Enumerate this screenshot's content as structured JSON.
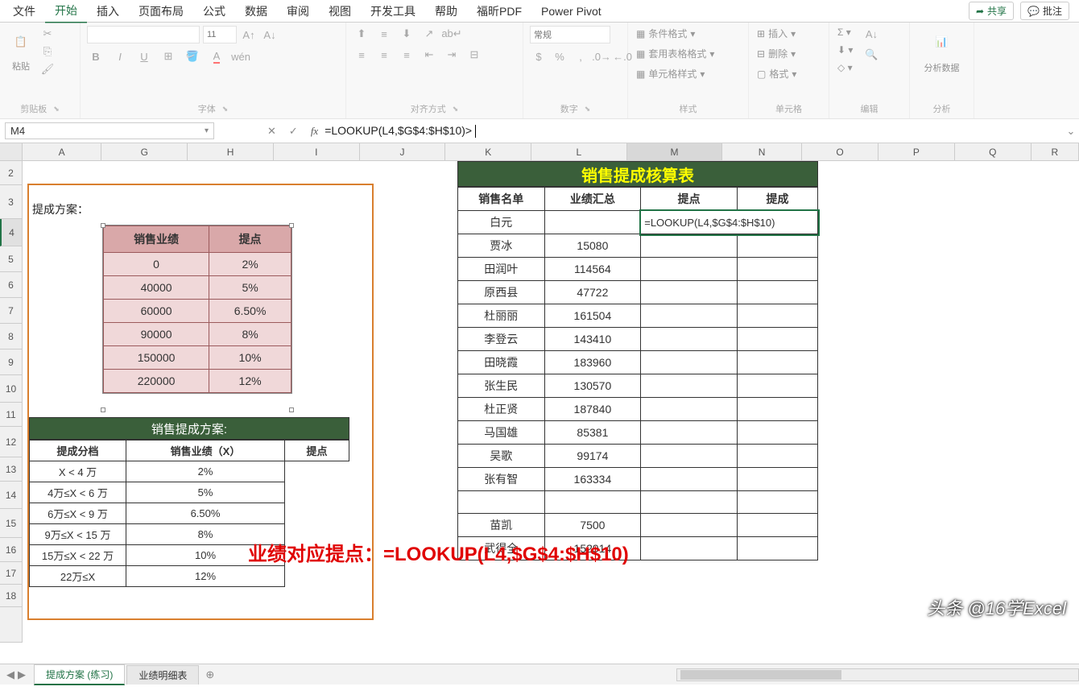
{
  "tabs": {
    "file": "文件",
    "home": "开始",
    "insert": "插入",
    "layout": "页面布局",
    "formulas": "公式",
    "data": "数据",
    "review": "审阅",
    "view": "视图",
    "dev": "开发工具",
    "help": "帮助",
    "foxit": "福昕PDF",
    "powerpivot": "Power Pivot"
  },
  "topright": {
    "share": "共享",
    "comment": "批注"
  },
  "ribbon": {
    "clipboard": {
      "paste": "粘贴",
      "label": "剪贴板"
    },
    "font": {
      "size": "11",
      "label": "字体"
    },
    "align": {
      "label": "对齐方式"
    },
    "number": {
      "format": "常规",
      "label": "数字"
    },
    "styles": {
      "cond": "条件格式",
      "table": "套用表格格式",
      "cell": "单元格样式",
      "label": "样式"
    },
    "cells": {
      "insert": "插入",
      "delete": "删除",
      "format": "格式",
      "label": "单元格"
    },
    "editing": {
      "label": "编辑"
    },
    "analysis": {
      "btn": "分析数据",
      "label": "分析"
    }
  },
  "formulabar": {
    "cellref": "M4",
    "formula": "=LOOKUP(L4,$G$4:$H$10)"
  },
  "columns": [
    "A",
    "G",
    "H",
    "I",
    "J",
    "K",
    "L",
    "M",
    "N",
    "O",
    "P",
    "Q",
    "R"
  ],
  "rownums": [
    "2",
    "3",
    "4",
    "5",
    "6",
    "7",
    "8",
    "9",
    "10",
    "11",
    "12",
    "13",
    "14",
    "15",
    "16",
    "17",
    "18",
    ""
  ],
  "leftbox": {
    "caption": "提成方案：",
    "pink_headers": [
      "销售业绩",
      "提点"
    ],
    "pink_rows": [
      [
        "0",
        "2%"
      ],
      [
        "40000",
        "5%"
      ],
      [
        "60000",
        "6.50%"
      ],
      [
        "90000",
        "8%"
      ],
      [
        "150000",
        "10%"
      ],
      [
        "220000",
        "12%"
      ]
    ],
    "scheme_title": "销售提成方案:",
    "scheme_header_left": "提成分档",
    "scheme_headers": [
      "销售业绩（X）",
      "提点"
    ],
    "scheme_rows": [
      [
        "X < 4 万",
        "2%"
      ],
      [
        "4万≤X < 6 万",
        "5%"
      ],
      [
        "6万≤X < 9 万",
        "6.50%"
      ],
      [
        "9万≤X < 15 万",
        "8%"
      ],
      [
        "15万≤X < 22 万",
        "10%"
      ],
      [
        "22万≤X",
        "12%"
      ]
    ]
  },
  "maintable": {
    "title": "销售提成核算表",
    "headers": [
      "销售名单",
      "业绩汇总",
      "提点",
      "提成"
    ],
    "formula_cell": "=LOOKUP(L4,$G$4:$H$10)",
    "rows": [
      [
        "白元",
        ""
      ],
      [
        "贾冰",
        "15080"
      ],
      [
        "田润叶",
        "114564"
      ],
      [
        "原西县",
        "47722"
      ],
      [
        "杜丽丽",
        "161504"
      ],
      [
        "李登云",
        "143410"
      ],
      [
        "田晓霞",
        "183960"
      ],
      [
        "张生民",
        "130570"
      ],
      [
        "杜正贤",
        "187840"
      ],
      [
        "马国雄",
        "85381"
      ],
      [
        "吴歌",
        "99174"
      ],
      [
        "张有智",
        "163334"
      ],
      [
        "",
        ""
      ],
      [
        "苗凯",
        "7500"
      ],
      [
        "武得全",
        "152914"
      ]
    ]
  },
  "annotation": "业绩对应提点：=LOOKUP(L4,$G$4:$H$10)",
  "watermark": "头条 @16学Excel",
  "sheettabs": {
    "active": "提成方案 (练习)",
    "other": "业绩明细表"
  }
}
